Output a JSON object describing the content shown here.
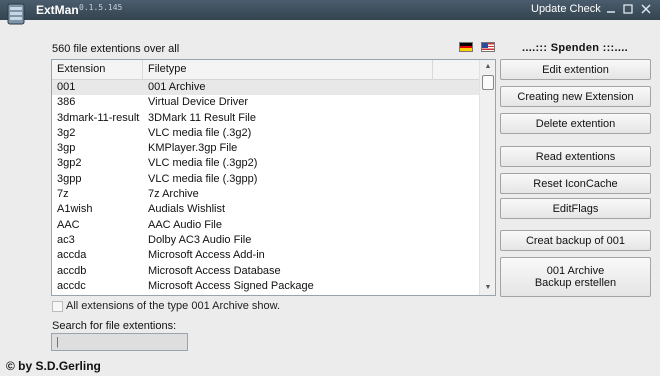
{
  "window": {
    "title": "ExtMan",
    "version": "0.1.5.145",
    "update_check": "Update Check"
  },
  "header": {
    "count_label": "560 file extentions over all",
    "donate_label": "....::: Spenden :::...."
  },
  "flags": [
    {
      "name": "german-flag",
      "colors": [
        "#000000",
        "#dd0000",
        "#ffce00"
      ]
    },
    {
      "name": "us-flag",
      "colors": [
        "#b22234",
        "#ffffff",
        "#3c3b6e"
      ]
    }
  ],
  "list": {
    "columns": [
      "Extension",
      "Filetype",
      ""
    ],
    "rows": [
      {
        "ext": "001",
        "type": "001 Archive",
        "selected": true
      },
      {
        "ext": "386",
        "type": "Virtual Device Driver"
      },
      {
        "ext": "3dmark-11-result",
        "type": "3DMark 11 Result File"
      },
      {
        "ext": "3g2",
        "type": "VLC media file (.3g2)"
      },
      {
        "ext": "3gp",
        "type": "KMPlayer.3gp File"
      },
      {
        "ext": "3gp2",
        "type": "VLC media file (.3gp2)"
      },
      {
        "ext": "3gpp",
        "type": "VLC media file (.3gpp)"
      },
      {
        "ext": "7z",
        "type": "7z Archive"
      },
      {
        "ext": "A1wish",
        "type": "Audials Wishlist"
      },
      {
        "ext": "AAC",
        "type": "AAC Audio File"
      },
      {
        "ext": "ac3",
        "type": "Dolby AC3 Audio File"
      },
      {
        "ext": "accda",
        "type": "Microsoft Access Add-in"
      },
      {
        "ext": "accdb",
        "type": "Microsoft Access Database"
      },
      {
        "ext": "accdc",
        "type": "Microsoft Access Signed Package"
      }
    ]
  },
  "show_all_label": "All extensions of the type 001 Archive show.",
  "search": {
    "label": "Search for file extentions:",
    "value": "",
    "placeholder": "|"
  },
  "buttons": {
    "edit": "Edit extention",
    "create": "Creating new Extension",
    "delete": "Delete extention",
    "read": "Read extentions",
    "reset": "Reset IconCache",
    "editflags": "EditFlags",
    "backup": "Creat backup of 001",
    "archive_line1": "001 Archive",
    "archive_line2": "Backup erstellen"
  },
  "footer": {
    "credit": "© by S.D.Gerling"
  }
}
